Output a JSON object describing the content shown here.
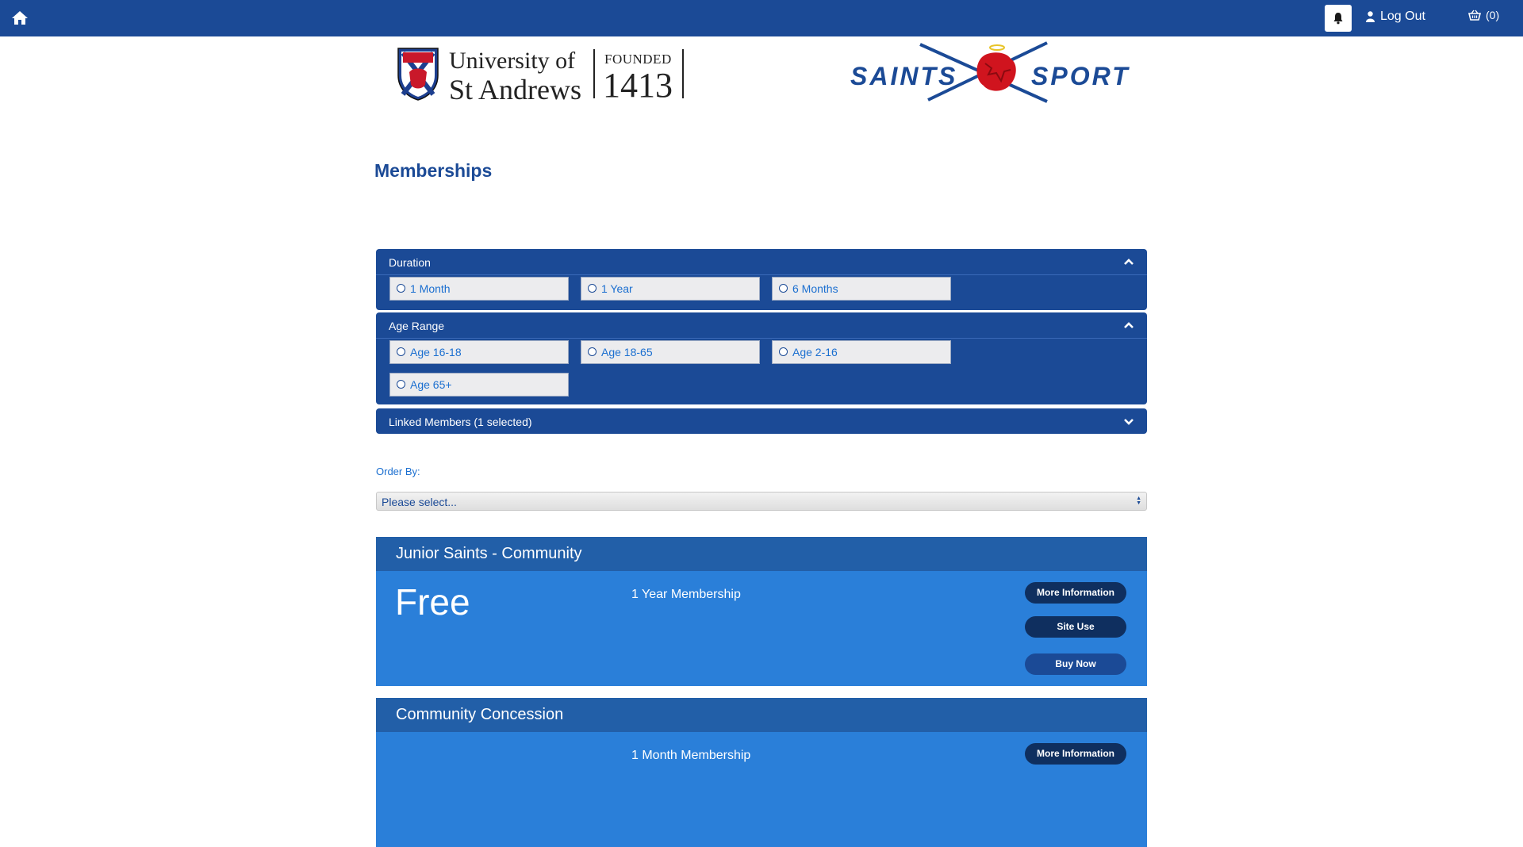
{
  "header": {
    "home_icon": "home-icon",
    "bell_icon": "bell-icon",
    "logout_label": "Log Out",
    "cart_count": "(0)"
  },
  "logos": {
    "university": {
      "line1": "University of",
      "line2": "St Andrews",
      "founded": "FOUNDED",
      "year": "1413"
    },
    "saints_sport": {
      "left_word": "SAINTS",
      "right_word": "SPORT"
    }
  },
  "page": {
    "title": "Memberships"
  },
  "filters": {
    "duration": {
      "label": "Duration",
      "options": [
        "1 Month",
        "1 Year",
        "6 Months"
      ]
    },
    "age_range": {
      "label": "Age Range",
      "options": [
        "Age 16-18",
        "Age 18-65",
        "Age 2-16",
        "Age 65+"
      ]
    },
    "linked_members": {
      "label": "Linked Members (1 selected)"
    }
  },
  "order_by": {
    "label": "Order By:",
    "selected": "Please select..."
  },
  "memberships": [
    {
      "name": "Junior Saints - Community",
      "price": "Free",
      "description": "1 Year Membership",
      "more_info": "More Information",
      "site_use": "Site Use",
      "buy_now": "Buy Now"
    },
    {
      "name": "Community Concession",
      "price": "",
      "description": "1 Month Membership",
      "more_info": "More Information"
    }
  ],
  "colors": {
    "brand_navy": "#1b4a96",
    "card_blue": "#2a7fd9",
    "card_header": "#225fa8",
    "button_dark": "#0f2f5f",
    "link_blue": "#1b6fd0"
  }
}
